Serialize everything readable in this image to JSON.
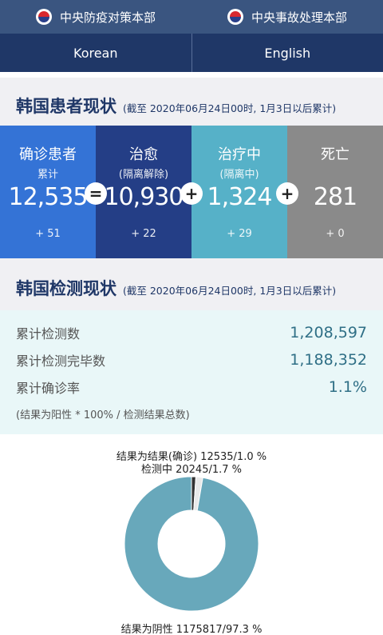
{
  "header": {
    "left_agency": "中央防疫对策本部",
    "right_agency": "中央事故处理本部",
    "left_emblem_icon": "taegeuk-emblem-icon",
    "right_emblem_icon": "taegeuk-emblem-icon"
  },
  "languages": [
    "Korean",
    "English"
  ],
  "patients": {
    "title": "韩国患者现状",
    "subtitle": "(截至 2020年06月24日00时, 1月3日以后累计)",
    "cards": [
      {
        "label": "确诊患者",
        "sub": "累计",
        "value": "12,535",
        "delta": "+ 51",
        "color": "#3473d6"
      },
      {
        "label": "治愈",
        "sub": "(隔离解除)",
        "value": "10,930",
        "delta": "+ 22",
        "color": "#243e86"
      },
      {
        "label": "治疗中",
        "sub": "(隔离中)",
        "value": "1,324",
        "delta": "+ 29",
        "color": "#56b1c8"
      },
      {
        "label": "死亡",
        "sub": "",
        "value": "281",
        "delta": "+ 0",
        "color": "#8a8a8a"
      }
    ],
    "operators": [
      "=",
      "+",
      "+"
    ]
  },
  "tests": {
    "title": "韩国检测现状",
    "subtitle": "(截至 2020年06月24日00时, 1月3日以后累计)",
    "rows": [
      {
        "label": "累计检测数",
        "value": "1,208,597"
      },
      {
        "label": "累计检测完毕数",
        "value": "1,188,352"
      },
      {
        "label": "累计确诊率",
        "value": "1.1%"
      }
    ],
    "note": "(结果为阳性 * 100% / 检测结果总数)"
  },
  "chart_data": {
    "type": "pie",
    "labels": [
      "结果为结果(确诊) 12535/1.0 %",
      "检测中 20245/1.7 %",
      "结果为阴性 1175817/97.3 %"
    ],
    "values": [
      12535,
      20245,
      1175817
    ],
    "percents": [
      1.0,
      1.7,
      97.3
    ],
    "colors": [
      "#333333",
      "#e9e9e9",
      "#68a8bb"
    ],
    "donut": true
  }
}
